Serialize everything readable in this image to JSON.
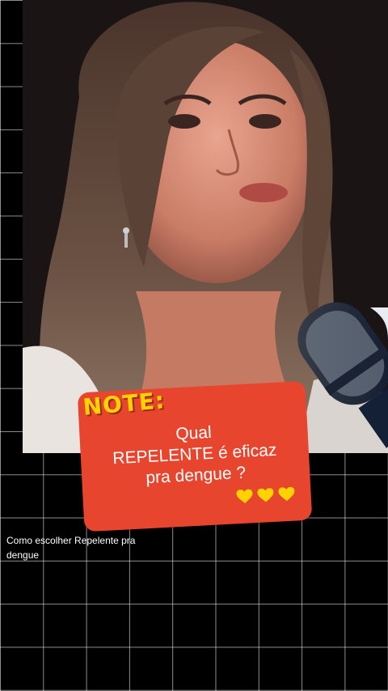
{
  "note": {
    "label": "NOTE:",
    "line1": "Qual",
    "line2": "REPELENTE é eficaz",
    "line3": "pra dengue ?",
    "hearts": 3,
    "label_color": "#ffd200",
    "card_color": "#e8452e"
  },
  "caption": {
    "text": "Como escolher Repelente pra dengue"
  },
  "background": {
    "color": "#000000",
    "grid_color": "#ffffff"
  }
}
